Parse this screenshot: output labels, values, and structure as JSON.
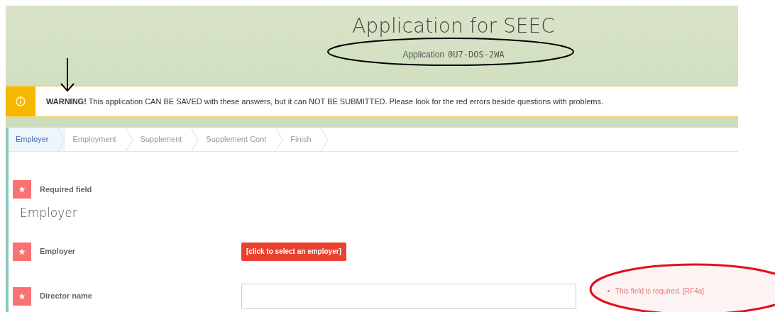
{
  "header": {
    "title": "Application for SEEC",
    "subtitle_label": "Application",
    "application_id": "0U7-DOS-2WA"
  },
  "warning": {
    "text": "**WARNING!** This application CAN BE SAVED with these answers, but it can NOT BE SUBMITTED. Please look for the red errors beside questions with problems."
  },
  "steps": [
    {
      "label": "Employer",
      "selected": true
    },
    {
      "label": "Employment",
      "selected": false
    },
    {
      "label": "Supplement",
      "selected": false
    },
    {
      "label": "Supplement Cont",
      "selected": false
    },
    {
      "label": "Finish",
      "selected": false
    }
  ],
  "legend": {
    "label": "Required field"
  },
  "section_title": "Employer",
  "fields": [
    {
      "kind": "button",
      "label": "Employer",
      "required": true,
      "button_label": "[click to select an employer]"
    },
    {
      "kind": "text",
      "label": "Director name",
      "required": true,
      "value_empty": true,
      "error": "This field is required. [RF4a]"
    }
  ]
}
